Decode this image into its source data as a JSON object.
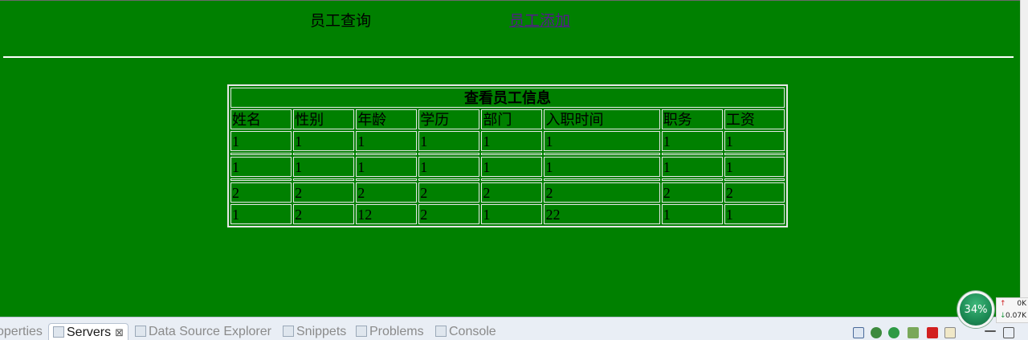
{
  "nav": {
    "query_label": "员工查询",
    "add_link": "员工添加"
  },
  "table": {
    "caption": "查看员工信息",
    "headers": [
      "姓名",
      "性别",
      "年龄",
      "学历",
      "部门",
      "入职时间",
      "职务",
      "工资"
    ],
    "rows": [
      [
        "1",
        "1",
        "1",
        "1",
        "1",
        "1",
        "1",
        "1"
      ],
      [
        "1",
        "1",
        "1",
        "1",
        "1",
        "1",
        "1",
        "1"
      ],
      [
        "2",
        "2",
        "2",
        "2",
        "2",
        "2",
        "2",
        "2"
      ],
      [
        "1",
        "2",
        "12",
        "2",
        "1",
        "22",
        "1",
        "1"
      ]
    ]
  },
  "ide": {
    "tabs": [
      {
        "label": "operties",
        "icon": "properties-icon"
      },
      {
        "label": "Servers",
        "icon": "servers-icon",
        "active": true
      },
      {
        "label": "Data Source Explorer",
        "icon": "database-icon"
      },
      {
        "label": "Snippets",
        "icon": "snippets-icon"
      },
      {
        "label": "Problems",
        "icon": "problems-icon"
      },
      {
        "label": "Console",
        "icon": "console-icon"
      }
    ],
    "close_glyph": "⊠"
  },
  "network_widget": {
    "percent": "34%",
    "upload": "0K",
    "download": "0.07K",
    "up_arrow": "↑",
    "down_arrow": "↓"
  },
  "colors": {
    "page_background": "#008000",
    "link_visited": "#551a8b",
    "table_border": "#e8e8e8"
  }
}
